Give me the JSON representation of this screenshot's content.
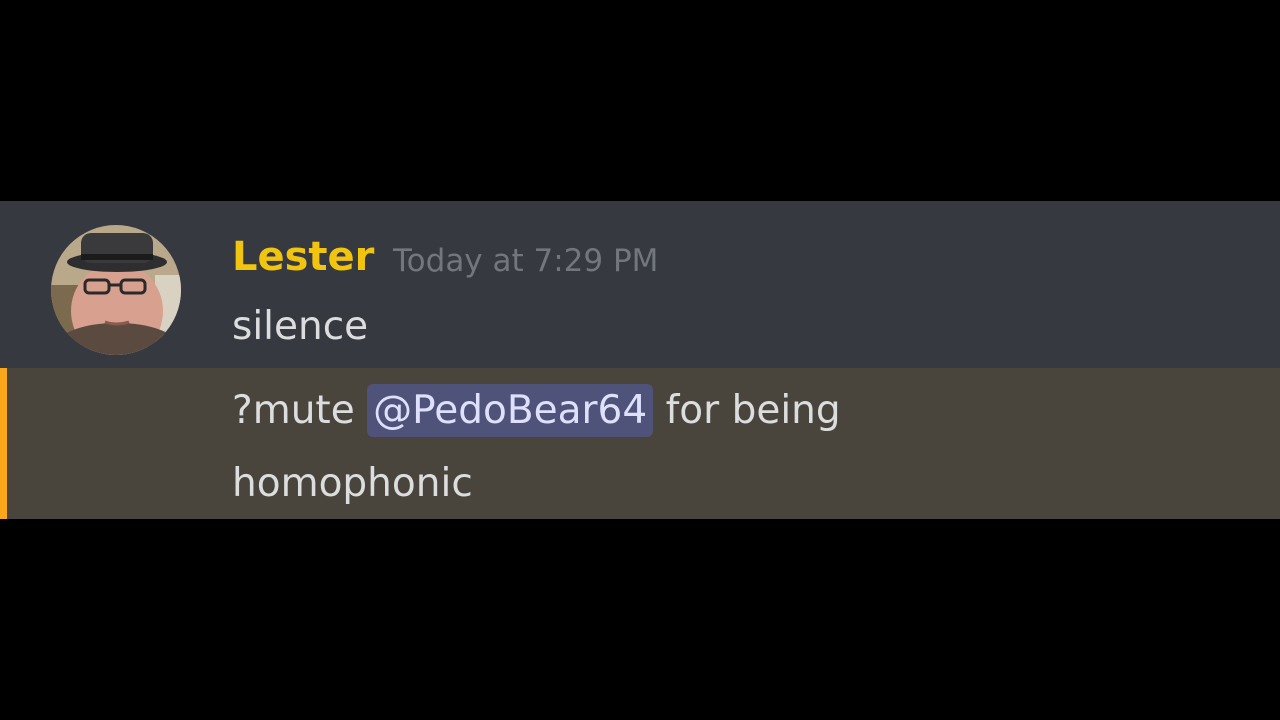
{
  "message": {
    "author": {
      "username": "Lester",
      "timestamp": "Today at 7:29 PM",
      "name_color": "#f1c40f"
    },
    "lines": [
      "silence"
    ],
    "mention_message": {
      "prefix": "?mute",
      "mention": "@PedoBear64",
      "suffix": "for being",
      "continuation": "homophonic"
    }
  },
  "colors": {
    "background": "#000000",
    "message_bg": "#36393f",
    "mention_highlight_bg": "#49443c",
    "mention_bar": "#faa81a",
    "mention_pill_bg": "#4f5279",
    "mention_pill_text": "#dee0fc",
    "text": "#dcddde",
    "timestamp": "#72767d"
  }
}
